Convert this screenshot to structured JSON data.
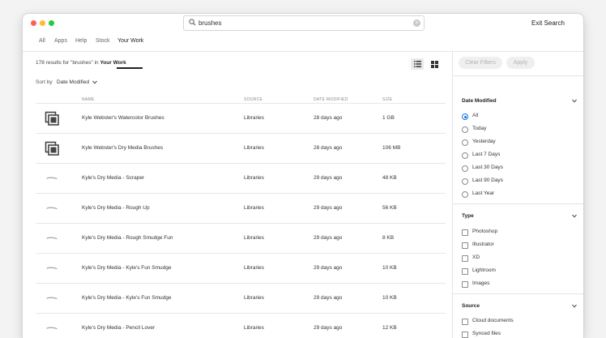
{
  "search": {
    "value": "brushes",
    "exit_label": "Exit Search"
  },
  "tabs": [
    {
      "label": "All"
    },
    {
      "label": "Apps"
    },
    {
      "label": "Help"
    },
    {
      "label": "Stock"
    },
    {
      "label": "Your Work",
      "active": true
    }
  ],
  "results": {
    "count": "178",
    "mid": " results for ",
    "query": "\"brushes\"",
    "in_text": " in ",
    "scope": "Your Work"
  },
  "sort": {
    "label": "Sort by",
    "value": "Date Modified"
  },
  "columns": {
    "name": "NAME",
    "source": "SOURCE",
    "date": "DATE MODIFIED",
    "size": "SIZE"
  },
  "rows": [
    {
      "icon": "library-icon",
      "name": "Kyle Webster's Watercolor Brushes",
      "source": "Libraries",
      "date": "28 days ago",
      "size": "1 GB"
    },
    {
      "icon": "library-icon",
      "name": "Kyle Webster's Dry Media Brushes",
      "source": "Libraries",
      "date": "28 days ago",
      "size": "106 MB"
    },
    {
      "icon": "brush-stroke-icon",
      "name": "Kyle's Dry Media - Scraper",
      "source": "Libraries",
      "date": "29 days ago",
      "size": "48 KB"
    },
    {
      "icon": "brush-stroke-icon",
      "name": "Kyle's Dry Media - Rough Up",
      "source": "Libraries",
      "date": "29 days ago",
      "size": "56 KB"
    },
    {
      "icon": "brush-stroke-icon",
      "name": "Kyle's Dry Media - Rough Smudge Fun",
      "source": "Libraries",
      "date": "29 days ago",
      "size": "8 KB"
    },
    {
      "icon": "brush-stroke-icon",
      "name": "Kyle's Dry Media - Kyle's Fun Smudge",
      "source": "Libraries",
      "date": "29 days ago",
      "size": "10 KB"
    },
    {
      "icon": "brush-stroke-icon",
      "name": "Kyle's Dry Media - Kyle's Fun Smudge",
      "source": "Libraries",
      "date": "29 days ago",
      "size": "10 KB"
    },
    {
      "icon": "brush-stroke-icon",
      "name": "Kyle's Dry Media - Pencil Lover",
      "source": "Libraries",
      "date": "29 days ago",
      "size": "12 KB"
    }
  ],
  "filters": {
    "clear_label": "Clear Filters",
    "apply_label": "Apply",
    "date_modified": {
      "title": "Date Modified",
      "selected": "All",
      "options": [
        "All",
        "Today",
        "Yesterday",
        "Last 7 Days",
        "Last 30 Days",
        "Last 90 Days",
        "Last Year"
      ]
    },
    "type": {
      "title": "Type",
      "options": [
        "Photoshop",
        "Illustrator",
        "XD",
        "Lightroom",
        "Images"
      ]
    },
    "source": {
      "title": "Source",
      "options": [
        "Cloud documents",
        "Synced files"
      ]
    }
  },
  "colors": {
    "accent": "#1473e6"
  }
}
